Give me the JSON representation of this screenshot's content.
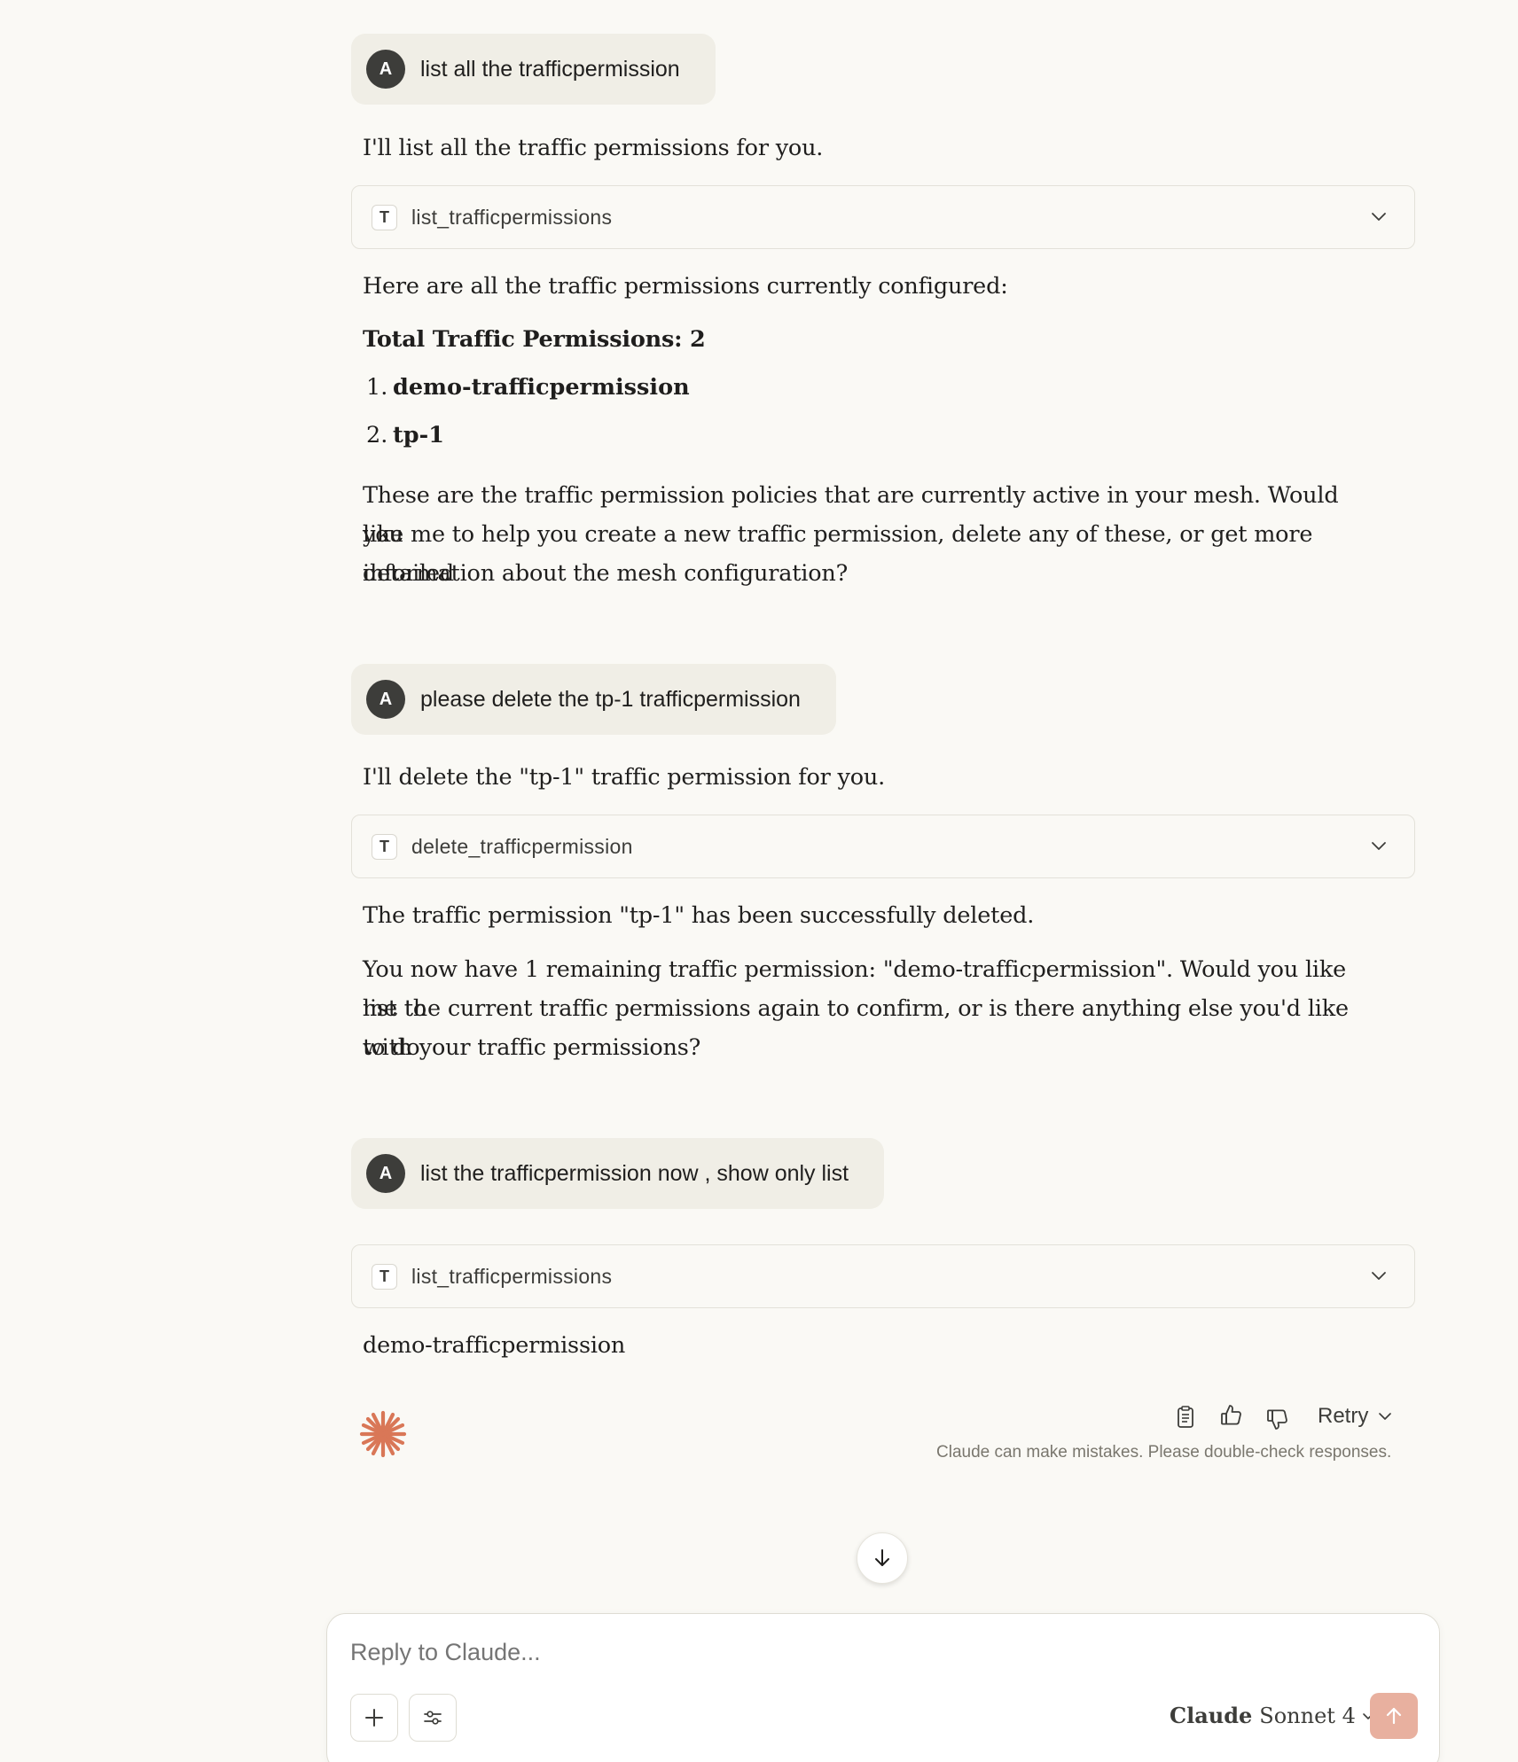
{
  "conversation": {
    "turn1": {
      "user_avatar": "A",
      "user_message": "list all the trafficpermission",
      "intro": "I'll list all the traffic permissions for you.",
      "tool_name": "list_trafficpermissions",
      "para1": "Here are all the traffic permissions currently configured:",
      "total_label": "Total Traffic Permissions: 2",
      "list": [
        {
          "num": "1.",
          "label": "demo-trafficpermission"
        },
        {
          "num": "2.",
          "label": "tp-1"
        }
      ],
      "para2_line1": "These are the traffic permission policies that are currently active in your mesh. Would you",
      "para2_line2": "like me to help you create a new traffic permission, delete any of these, or get more detailed",
      "para2_line3": "information about the mesh configuration?"
    },
    "turn2": {
      "user_avatar": "A",
      "user_message": "please delete the tp-1 trafficpermission",
      "intro": "I'll delete the \"tp-1\" traffic permission for you.",
      "tool_name": "delete_trafficpermission",
      "para1": "The traffic permission \"tp-1\" has been successfully deleted.",
      "para2_line1": "You now have 1 remaining traffic permission: \"demo-trafficpermission\". Would you like me to",
      "para2_line2": "list the current traffic permissions again to confirm, or is there anything else you'd like to do",
      "para2_line3": "with your traffic permissions?"
    },
    "turn3": {
      "user_avatar": "A",
      "user_message": "list the trafficpermission now , show only list",
      "tool_name": "list_trafficpermissions",
      "result": "demo-trafficpermission"
    }
  },
  "actions": {
    "retry_label": "Retry",
    "disclaimer": "Claude can make mistakes. Please double-check responses."
  },
  "composer": {
    "placeholder": "Reply to Claude...",
    "model_brand": "Claude",
    "model_name": "Sonnet 4"
  },
  "colors": {
    "background": "#faf9f5",
    "user_bubble": "#f0eee6",
    "avatar": "#3d3d3a",
    "claude_accent": "#d97757",
    "send_button": "#e8b09f"
  }
}
